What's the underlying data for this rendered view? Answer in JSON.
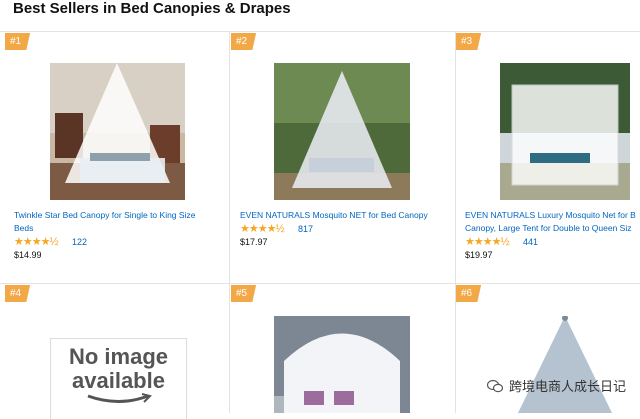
{
  "page_title": "Best Sellers in Bed Canopies & Drapes",
  "watermark": {
    "icon": "wechat-icon",
    "text": "跨境电商人成长日记"
  },
  "products": [
    {
      "rank": "#1",
      "name": "Twinkle Star Bed Canopy for Single to King Size",
      "name2": "Beds",
      "stars": "★★★★½",
      "reviews": "122",
      "price": "$14.99"
    },
    {
      "rank": "#2",
      "name": "EVEN NATURALS Mosquito NET for Bed Canopy",
      "stars": "★★★★½",
      "reviews": "817",
      "price": "$17.97"
    },
    {
      "rank": "#3",
      "name": "EVEN NATURALS Luxury Mosquito Net for B",
      "name2": "Canopy, Large Tent for Double to Queen Siz",
      "stars": "★★★★½",
      "reviews": "441",
      "price": "$19.97"
    },
    {
      "rank": "#4",
      "placeholder_line1": "No image",
      "placeholder_line2": "available"
    },
    {
      "rank": "#5"
    },
    {
      "rank": "#6"
    }
  ]
}
